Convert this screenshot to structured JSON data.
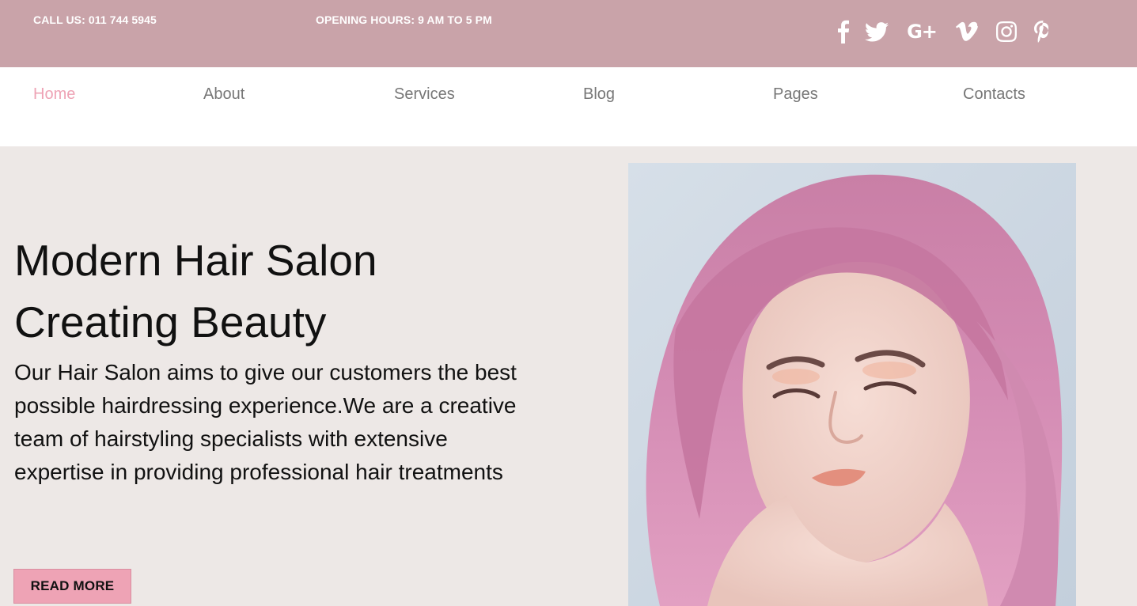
{
  "topbar": {
    "call": "CALL US: 011 744 5945",
    "hours": "OPENING HOURS: 9 AM TO 5 PM",
    "social": [
      {
        "name": "facebook-icon"
      },
      {
        "name": "twitter-icon"
      },
      {
        "name": "google-plus-icon",
        "label": "G+"
      },
      {
        "name": "vimeo-icon"
      },
      {
        "name": "instagram-icon"
      },
      {
        "name": "pinterest-icon"
      }
    ]
  },
  "nav": {
    "items": [
      {
        "label": "Home",
        "active": true
      },
      {
        "label": "About"
      },
      {
        "label": "Services"
      },
      {
        "label": "Blog"
      },
      {
        "label": "Pages"
      },
      {
        "label": "Contacts"
      }
    ]
  },
  "hero": {
    "title_line1": "Modern Hair Salon",
    "title_line2": "Creating Beauty",
    "description": "Our Hair Salon aims to give our customers the best possible hairdressing experience.We are a creative team of hairstyling specialists with extensive expertise in providing professional hair treatments",
    "button_label": "READ MORE"
  },
  "colors": {
    "topbar_bg": "#c9a3a9",
    "accent_pink": "#eea3b5",
    "hero_bg": "#ede8e6",
    "nav_text": "#777777"
  }
}
